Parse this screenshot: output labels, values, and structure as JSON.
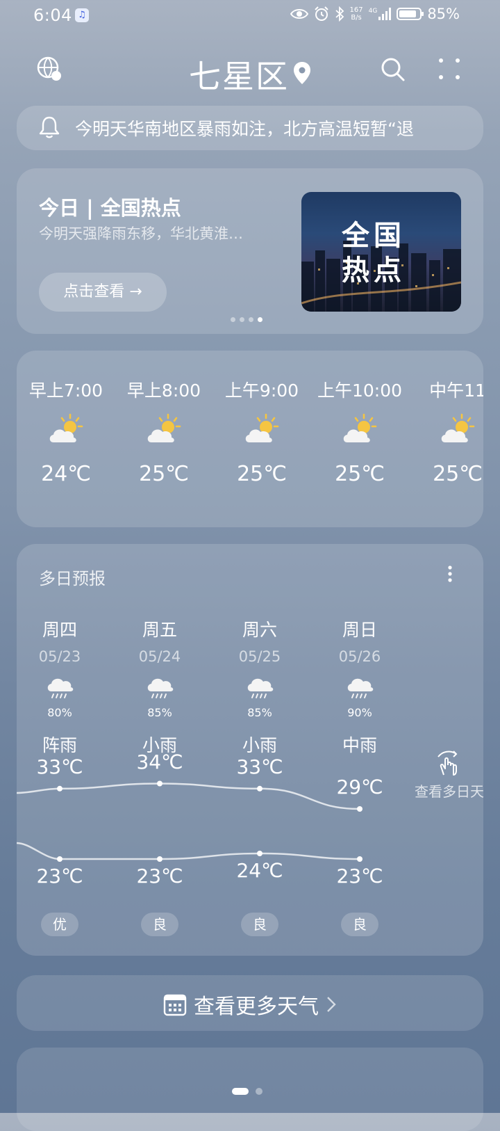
{
  "status_bar": {
    "time": "6:04",
    "net_speed_value": "167",
    "net_speed_unit": "B/s",
    "network": "4G",
    "battery_level": 0.85,
    "battery_text": "85%"
  },
  "header": {
    "city": "七星区"
  },
  "notice": {
    "text": "今明天华南地区暴雨如注，北方高温短暂“退"
  },
  "news": {
    "title": "今日 | 全国热点",
    "subtitle": "今明天强降雨东移，华北黄淮…",
    "button_label": "点击查看 →",
    "image_text_line1": "全国",
    "image_text_line2": "热点",
    "page_count": 4,
    "active_page": 4
  },
  "hourly": [
    {
      "time": "早上7:00",
      "icon": "partly-cloudy-sun-icon",
      "temp": "24℃"
    },
    {
      "time": "早上8:00",
      "icon": "partly-cloudy-sun-icon",
      "temp": "25℃"
    },
    {
      "time": "上午9:00",
      "icon": "partly-cloudy-sun-icon",
      "temp": "25℃"
    },
    {
      "time": "上午10:00",
      "icon": "partly-cloudy-sun-icon",
      "temp": "25℃"
    },
    {
      "time": "中午11",
      "icon": "partly-cloudy-sun-icon",
      "temp": "25℃"
    }
  ],
  "forecast": {
    "title": "多日预报",
    "side_label": "查看多日天",
    "days": [
      {
        "name": "周四",
        "date": "05/23",
        "rain": "80%",
        "cond": "阵雨",
        "hi": "33℃",
        "lo": "23℃",
        "hi_value": 33,
        "lo_value": 23,
        "aqi": "优",
        "icon": "rain-cloud-icon"
      },
      {
        "name": "周五",
        "date": "05/24",
        "rain": "85%",
        "cond": "小雨",
        "hi": "34℃",
        "lo": "23℃",
        "hi_value": 34,
        "lo_value": 23,
        "aqi": "良",
        "icon": "rain-cloud-icon"
      },
      {
        "name": "周六",
        "date": "05/25",
        "rain": "85%",
        "cond": "小雨",
        "hi": "33℃",
        "lo": "24℃",
        "hi_value": 33,
        "lo_value": 24,
        "aqi": "良",
        "icon": "rain-cloud-icon"
      },
      {
        "name": "周日",
        "date": "05/26",
        "rain": "90%",
        "cond": "中雨",
        "hi": "29℃",
        "lo": "23℃",
        "hi_value": 29,
        "lo_value": 23,
        "aqi": "良",
        "icon": "rain-cloud-icon"
      }
    ]
  },
  "more_weather": {
    "label": "查看更多天气"
  },
  "pager": {
    "count": 2,
    "active": 1
  }
}
